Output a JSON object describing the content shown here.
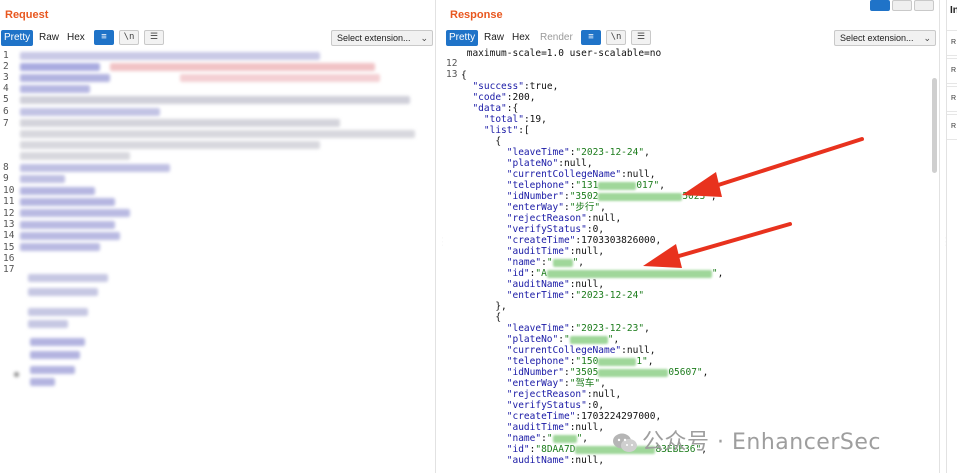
{
  "request": {
    "title": "Request",
    "tabs": [
      "Pretty",
      "Raw",
      "Hex"
    ],
    "active_tab": "Pretty",
    "wrap_icon": "wrap-lines-icon",
    "newline_toggle": "\\n",
    "menu_icon": "hamburger-menu-icon",
    "extension_select": "Select extension...",
    "line_numbers": [
      "1",
      "2",
      "3",
      "4",
      "5",
      "6",
      "7",
      "8",
      "9",
      "10",
      "11",
      "12",
      "13",
      "14",
      "15",
      "16",
      "17"
    ]
  },
  "response": {
    "title": "Response",
    "tabs": [
      "Pretty",
      "Raw",
      "Hex",
      "Render"
    ],
    "active_tab": "Pretty",
    "newline_toggle": "\\n",
    "extension_select": "Select extension...",
    "first_line": "maximum-scale=1.0 user-scalable=no",
    "line_numbers": [
      "",
      "12",
      "13"
    ],
    "json": {
      "success": "true",
      "code": "200",
      "total": "19",
      "records": [
        {
          "leaveTime": "\"2023-12-24\"",
          "plateNo": "null",
          "currentCollegeName": "null",
          "telephone_prefix": "\"131",
          "telephone_suffix": "017\"",
          "idNumber_prefix": "\"3502",
          "idNumber_suffix": "5023\"",
          "enterWay": "\"步行\"",
          "rejectReason": "null",
          "verifyStatus": "0",
          "createTime": "1703303826000",
          "auditTime": "null",
          "name_prefix": "\"",
          "name_suffix": "\"",
          "id_prefix": "\"A",
          "id_suffix": "\"",
          "auditName": "null",
          "enterTime": "\"2023-12-24\""
        },
        {
          "leaveTime": "\"2023-12-23\"",
          "plateNo_prefix": "\"",
          "plateNo_suffix": "\"",
          "currentCollegeName": "null",
          "telephone_prefix": "\"150",
          "telephone_suffix": "1\"",
          "idNumber_prefix": "\"3505",
          "idNumber_suffix": "05607\"",
          "enterWay": "\"驾车\"",
          "rejectReason": "null",
          "verifyStatus": "0",
          "createTime": "1703224297000",
          "auditTime": "null",
          "name_prefix": "\"",
          "name_suffix": "\"",
          "id_prefix": "\"8DAA7D",
          "id_suffix": "83EBE36\"",
          "auditName": "null"
        }
      ]
    }
  },
  "inspector": {
    "title": "In",
    "rows": [
      "R",
      "R",
      "R",
      "R"
    ]
  },
  "layout_buttons": [
    "split-horizontal-icon",
    "split-vertical-icon",
    "single-pane-icon"
  ],
  "watermark": {
    "text": "公众号 · EnhancerSec",
    "logo": "wechat-logo-icon"
  },
  "colors": {
    "accent": "#e8571f",
    "active_tab": "#1f73c8",
    "json_key": "#1a1aa6",
    "json_string": "#1c7c1c",
    "annotation_arrow": "#e8321e"
  }
}
